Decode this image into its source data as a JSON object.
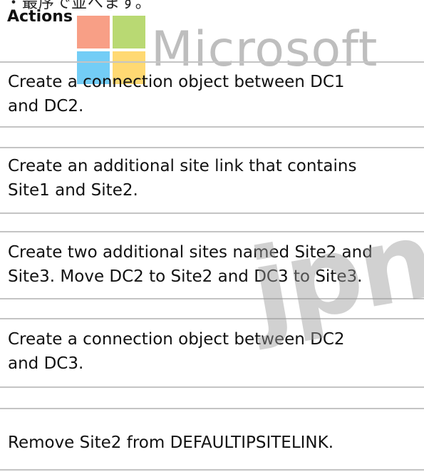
{
  "header": {
    "top_fragment": "・最序で並べます。",
    "title": "Actions"
  },
  "watermarks": {
    "microsoft": "Microsoft",
    "jp": "jpnp",
    "logo_colors": [
      "#f25022",
      "#7fba00",
      "#00a4ef",
      "#ffb900"
    ]
  },
  "actions": [
    "Create a connection object between DC1\nand DC2.",
    "Create an additional site link that contains\nSite1 and Site2.",
    "Create two additional sites named Site2 and\nSite3. Move DC2 to Site2 and DC3 to Site3.",
    "Create a connection object between DC2\nand DC3.",
    "Remove Site2 from DEFAULTIPSITELINK."
  ]
}
